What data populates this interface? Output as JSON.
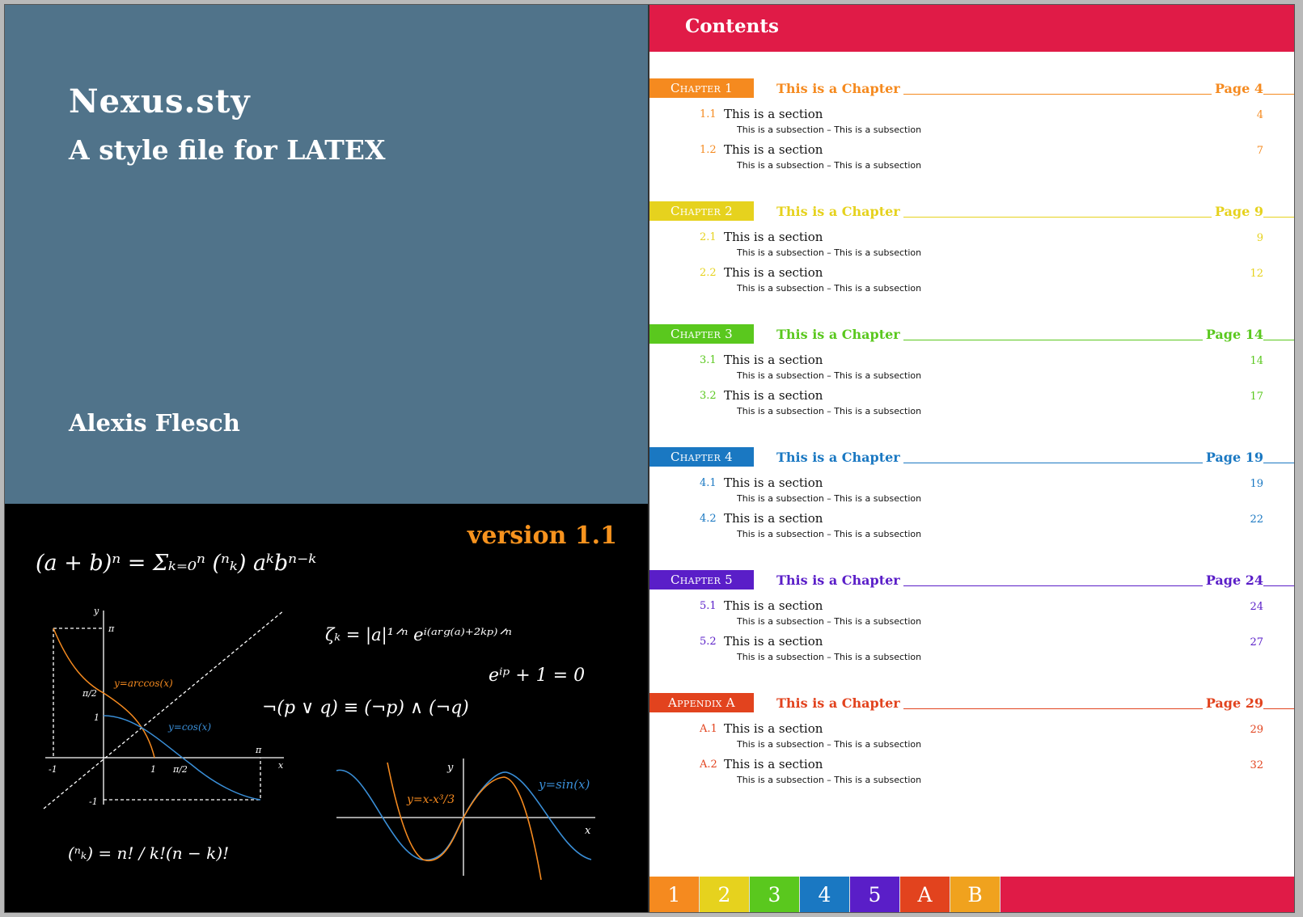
{
  "cover": {
    "title": "Nexus.sty",
    "subtitle": "A style file for LATEX",
    "author": "Alexis Flesch",
    "version": "version 1.1",
    "formulas": [
      "(a + b)ⁿ = Σₖ₌₀ⁿ (ⁿₖ) aᵏbⁿ⁻ᵏ",
      "ζₖ = |a|¹ᐟⁿ eⁱ⁽ᵃʳᵍ⁽ᵃ⁾⁺²ᵏᵖ⁾ᐟⁿ",
      "eⁱᵖ + 1 = 0",
      "¬(p ∨ q) ≡ (¬p) ∧ (¬q)",
      "(ⁿₖ) = n! / k!(n − k)!"
    ],
    "plot1": {
      "label_arccos": "y=arccos(x)",
      "label_cos": "y=cos(x)",
      "ticks": [
        "-1",
        "1",
        "π/2",
        "π",
        "-1",
        "1",
        "π/2",
        "π"
      ],
      "axis_x": "x",
      "axis_y": "y"
    },
    "plot2": {
      "label_cubic": "y=x-x³/3",
      "label_sin": "y=sin(x)",
      "axis_x": "x",
      "axis_y": "y"
    }
  },
  "toc": {
    "title": "Contents",
    "chapters": [
      {
        "label": "Chapter 1",
        "title": "This is a Chapter",
        "page": "Page 4",
        "color": "#f58a1f",
        "sections": [
          {
            "num": "1.1",
            "title": "This is a section",
            "page": "4",
            "sub": "This is a subsection – This is a subsection"
          },
          {
            "num": "1.2",
            "title": "This is a section",
            "page": "7",
            "sub": "This is a subsection – This is a subsection"
          }
        ]
      },
      {
        "label": "Chapter 2",
        "title": "This is a Chapter",
        "page": "Page 9",
        "color": "#e6d21e",
        "sections": [
          {
            "num": "2.1",
            "title": "This is a section",
            "page": "9",
            "sub": "This is a subsection – This is a subsection"
          },
          {
            "num": "2.2",
            "title": "This is a section",
            "page": "12",
            "sub": "This is a subsection – This is a subsection"
          }
        ]
      },
      {
        "label": "Chapter 3",
        "title": "This is a Chapter",
        "page": "Page 14",
        "color": "#5ac81e",
        "sections": [
          {
            "num": "3.1",
            "title": "This is a section",
            "page": "14",
            "sub": "This is a subsection – This is a subsection"
          },
          {
            "num": "3.2",
            "title": "This is a section",
            "page": "17",
            "sub": "This is a subsection – This is a subsection"
          }
        ]
      },
      {
        "label": "Chapter 4",
        "title": "This is a Chapter",
        "page": "Page 19",
        "color": "#1a78c2",
        "sections": [
          {
            "num": "4.1",
            "title": "This is a section",
            "page": "19",
            "sub": "This is a subsection – This is a subsection"
          },
          {
            "num": "4.2",
            "title": "This is a section",
            "page": "22",
            "sub": "This is a subsection – This is a subsection"
          }
        ]
      },
      {
        "label": "Chapter 5",
        "title": "This is a Chapter",
        "page": "Page 24",
        "color": "#5a1ec8",
        "sections": [
          {
            "num": "5.1",
            "title": "This is a section",
            "page": "24",
            "sub": "This is a subsection – This is a subsection"
          },
          {
            "num": "5.2",
            "title": "This is a section",
            "page": "27",
            "sub": "This is a subsection – This is a subsection"
          }
        ]
      },
      {
        "label": "Appendix A",
        "title": "This is a Chapter",
        "page": "Page 29",
        "color": "#e2431e",
        "sections": [
          {
            "num": "A.1",
            "title": "This is a section",
            "page": "29",
            "sub": "This is a subsection – This is a subsection"
          },
          {
            "num": "A.2",
            "title": "This is a section",
            "page": "32",
            "sub": "This is a subsection – This is a subsection"
          }
        ]
      }
    ],
    "tabs": [
      {
        "label": "1",
        "color": "#f58a1f"
      },
      {
        "label": "2",
        "color": "#e6d21e"
      },
      {
        "label": "3",
        "color": "#5ac81e"
      },
      {
        "label": "4",
        "color": "#1a78c2"
      },
      {
        "label": "5",
        "color": "#5a1ec8"
      },
      {
        "label": "A",
        "color": "#e2431e"
      },
      {
        "label": "B",
        "color": "#f0a21e"
      }
    ]
  }
}
